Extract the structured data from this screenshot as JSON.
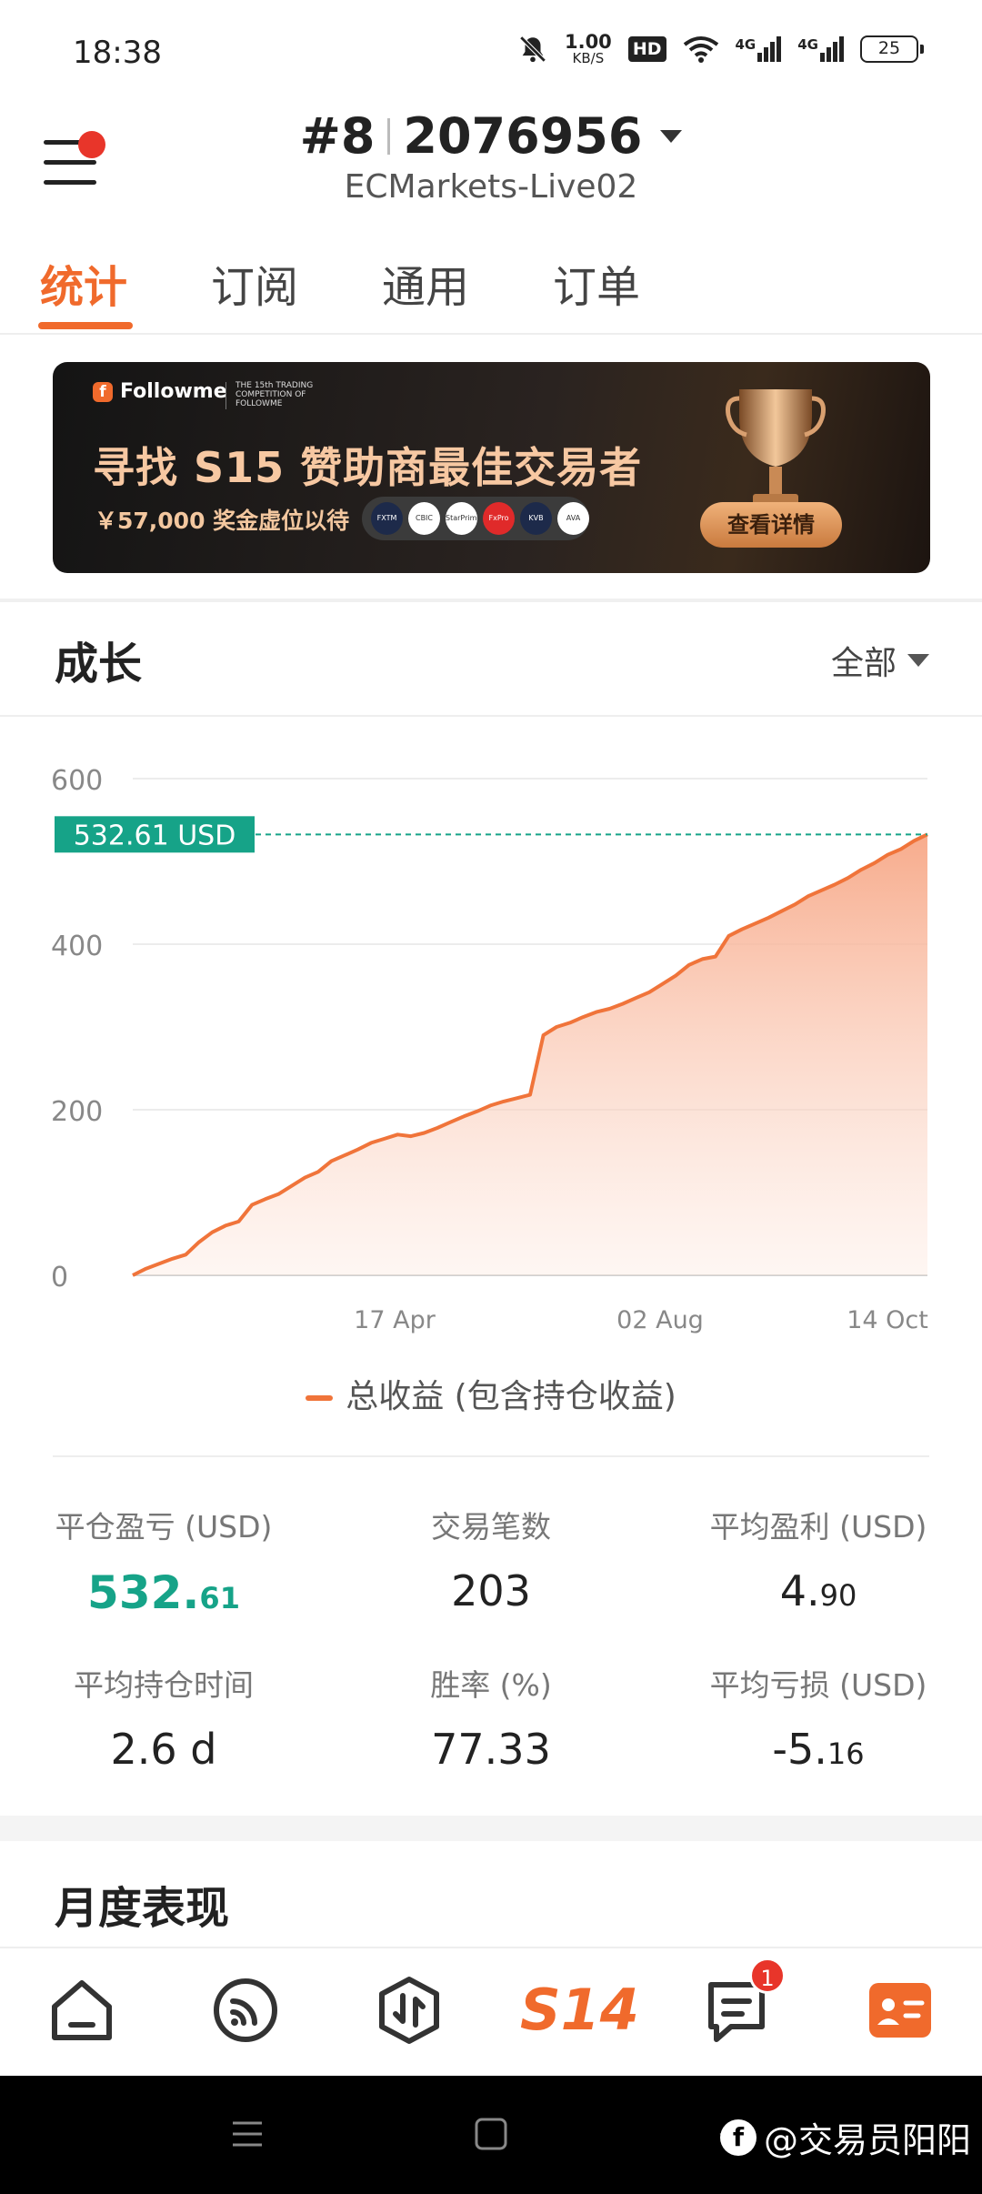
{
  "status_bar": {
    "time": "18:38",
    "net_speed_value": "1.00",
    "net_speed_unit": "KB/S",
    "hd_label": "HD",
    "net1": "4G",
    "net2": "4G",
    "battery": "25",
    "icons": [
      "mute-bell-icon",
      "wifi-icon",
      "signal-icon",
      "battery-icon"
    ]
  },
  "header": {
    "rank": "#8",
    "account": "2076956",
    "server": "ECMarkets-Live02"
  },
  "tabs": [
    {
      "label": "统计",
      "active": true
    },
    {
      "label": "订阅",
      "active": false
    },
    {
      "label": "通用",
      "active": false
    },
    {
      "label": "订单",
      "active": false
    }
  ],
  "banner": {
    "brand": "Followme",
    "competition": "THE 15th TRADING COMPETITION OF FOLLOWME",
    "title": "寻找 S15 赞助商最佳交易者",
    "subtitle": "￥57,000 奖金虚位以待",
    "sponsors": [
      "FXTM",
      "CBIC",
      "StarPrime",
      "FxPro",
      "KVB",
      "AVA TRADE"
    ],
    "button": "查看详情"
  },
  "growth": {
    "title": "成长",
    "filter": "全部",
    "current_label": "532.61 USD",
    "legend": "总收益 (包含持仓收益)"
  },
  "chart_data": {
    "type": "area",
    "x_tick_labels": [
      "17 Apr",
      "02 Aug",
      "14 Oct"
    ],
    "ylim": [
      0,
      600
    ],
    "y_ticks": [
      0,
      200,
      400,
      600
    ],
    "current_value": 532.61,
    "series": [
      {
        "name": "总收益 (包含持仓收益)",
        "color": "#f0743a",
        "values": [
          0,
          8,
          14,
          20,
          25,
          40,
          52,
          60,
          65,
          85,
          92,
          98,
          108,
          118,
          125,
          138,
          145,
          152,
          160,
          165,
          170,
          168,
          172,
          178,
          185,
          192,
          198,
          205,
          210,
          214,
          218,
          290,
          300,
          305,
          312,
          318,
          322,
          328,
          335,
          342,
          352,
          362,
          375,
          382,
          385,
          410,
          418,
          425,
          432,
          440,
          448,
          458,
          465,
          472,
          480,
          490,
          498,
          508,
          515,
          525,
          532.61
        ]
      }
    ]
  },
  "stats": [
    {
      "label": "平仓盈亏 (USD)",
      "main": "532.",
      "small": "61",
      "highlight": true
    },
    {
      "label": "交易笔数",
      "main": "203",
      "small": "",
      "highlight": false
    },
    {
      "label": "平均盈利 (USD)",
      "main": "4.",
      "small": "90",
      "highlight": false
    },
    {
      "label": "平均持仓时间",
      "main": "2.6 d",
      "small": "",
      "highlight": false
    },
    {
      "label": "胜率 (%)",
      "main": "77.33",
      "small": "",
      "highlight": false
    },
    {
      "label": "平均亏损 (USD)",
      "main": "-5.",
      "small": "16",
      "highlight": false
    }
  ],
  "monthly": {
    "title": "月度表现"
  },
  "bottom_nav": {
    "items": [
      "home-icon",
      "feed-icon",
      "trade-icon",
      "s14-icon",
      "messages-icon",
      "profile-icon"
    ],
    "s14_label": "S14",
    "messages_badge": "1"
  },
  "watermark": "@交易员阳阳"
}
